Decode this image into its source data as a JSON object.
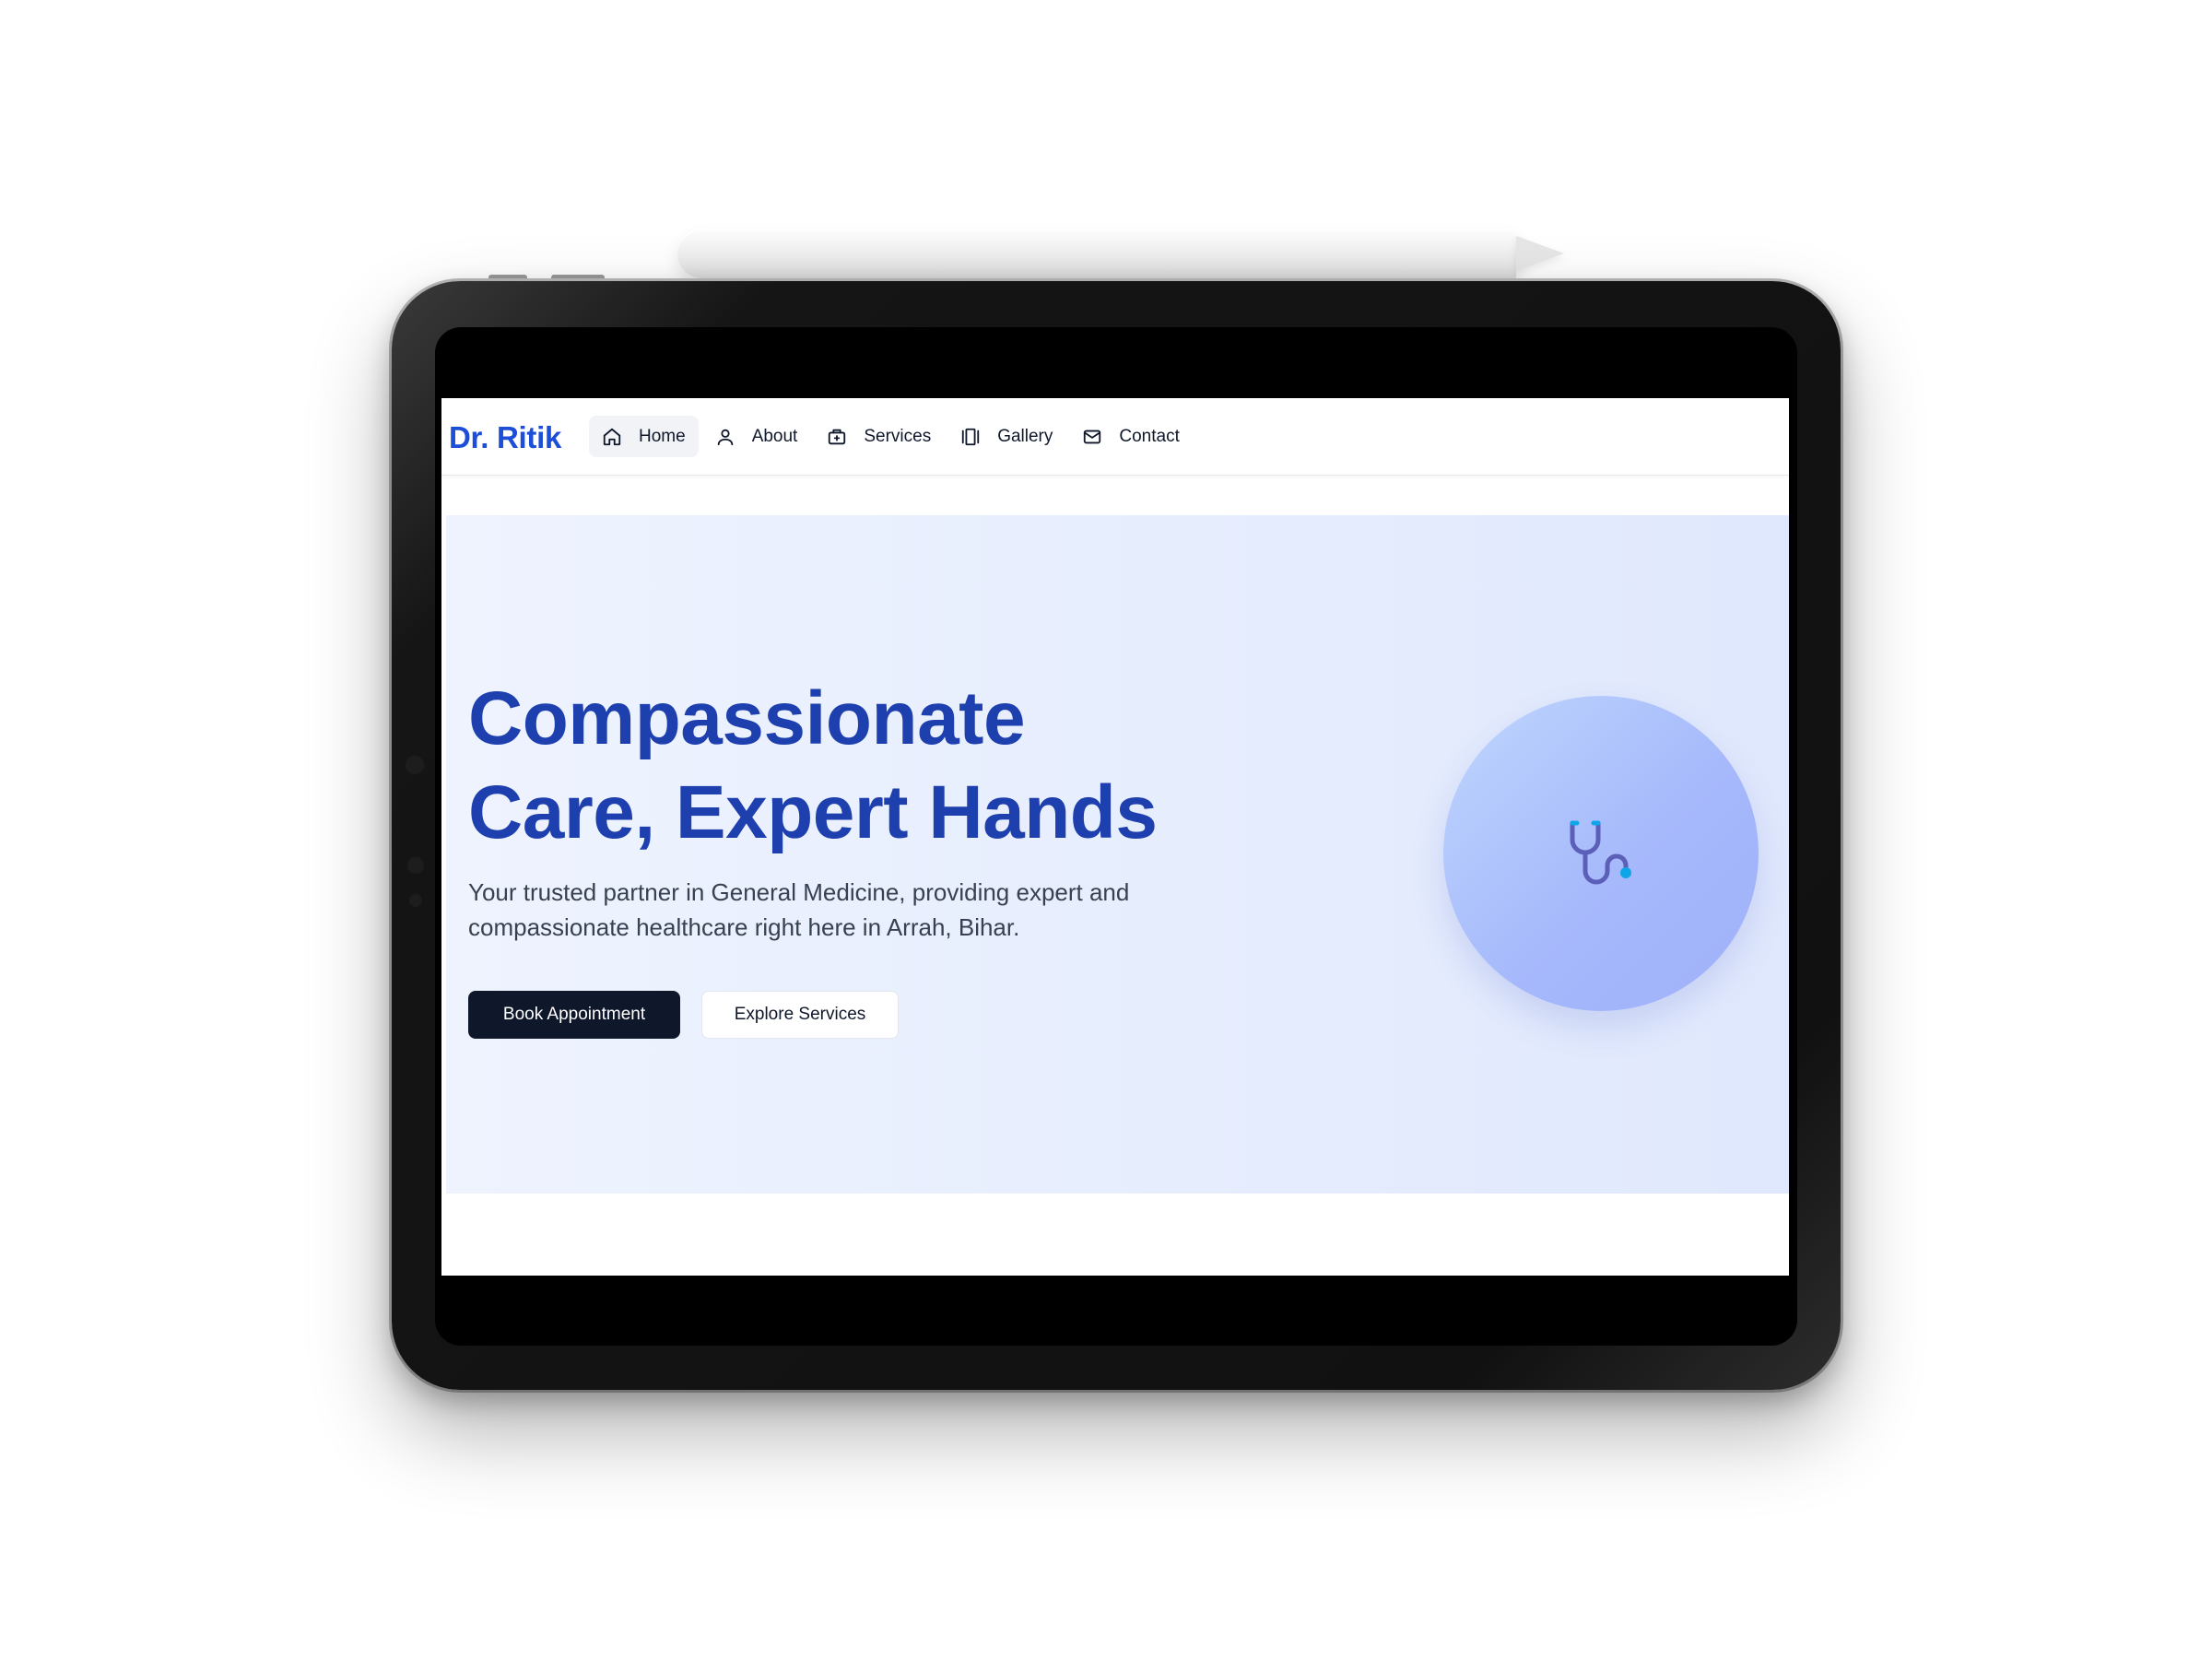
{
  "site": {
    "brand": "Dr. Ritik"
  },
  "nav": {
    "items": [
      {
        "label": "Home",
        "icon": "home-icon",
        "active": true
      },
      {
        "label": "About",
        "icon": "user-icon",
        "active": false
      },
      {
        "label": "Services",
        "icon": "briefcase-medical-icon",
        "active": false
      },
      {
        "label": "Gallery",
        "icon": "gallery-icon",
        "active": false
      },
      {
        "label": "Contact",
        "icon": "mail-icon",
        "active": false
      }
    ]
  },
  "hero": {
    "title_line1": "Compassionate",
    "title_line2": "Care, Expert Hands",
    "subtitle": "Your trusted partner in General Medicine, providing expert and compassionate healthcare right here in Arrah, Bihar.",
    "primary_button": "Book Appointment",
    "secondary_button": "Explore Services",
    "illustration_icon": "stethoscope-icon"
  },
  "colors": {
    "brand": "#1d4ed8",
    "title": "#1e40af",
    "primary_button": "#0f172a",
    "hero_background": "#e6edfd"
  }
}
